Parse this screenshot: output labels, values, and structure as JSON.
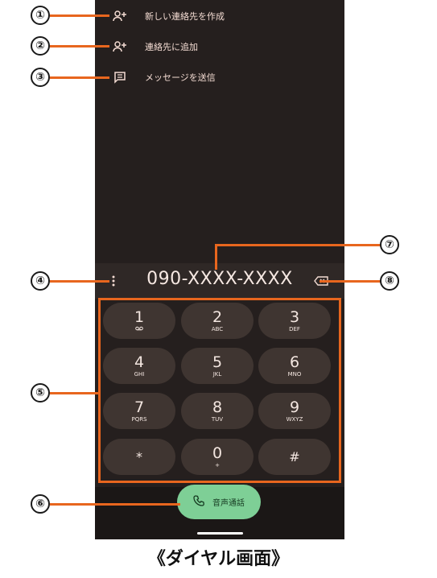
{
  "menu": {
    "items": [
      {
        "label": "新しい連絡先を作成",
        "icon": "add-person-icon"
      },
      {
        "label": "連絡先に追加",
        "icon": "add-person-icon"
      },
      {
        "label": "メッセージを送信",
        "icon": "message-icon"
      }
    ]
  },
  "dialer": {
    "number": "090-XXXX-XXXX",
    "call_label": "音声通話",
    "keys": [
      {
        "digit": "1",
        "letters": "ﾛﾛ"
      },
      {
        "digit": "2",
        "letters": "ABC"
      },
      {
        "digit": "3",
        "letters": "DEF"
      },
      {
        "digit": "4",
        "letters": "GHI"
      },
      {
        "digit": "5",
        "letters": "JKL"
      },
      {
        "digit": "6",
        "letters": "MNO"
      },
      {
        "digit": "7",
        "letters": "PQRS"
      },
      {
        "digit": "8",
        "letters": "TUV"
      },
      {
        "digit": "9",
        "letters": "WXYZ"
      },
      {
        "digit": "*",
        "letters": ""
      },
      {
        "digit": "0",
        "letters": "+"
      },
      {
        "digit": "#",
        "letters": ""
      }
    ]
  },
  "callouts": [
    "①",
    "②",
    "③",
    "④",
    "⑤",
    "⑥",
    "⑦",
    "⑧"
  ],
  "caption": "《ダイヤル画面》",
  "colors": {
    "accent": "#e8661e",
    "call": "#7ecf96",
    "background": "#251f1e"
  }
}
